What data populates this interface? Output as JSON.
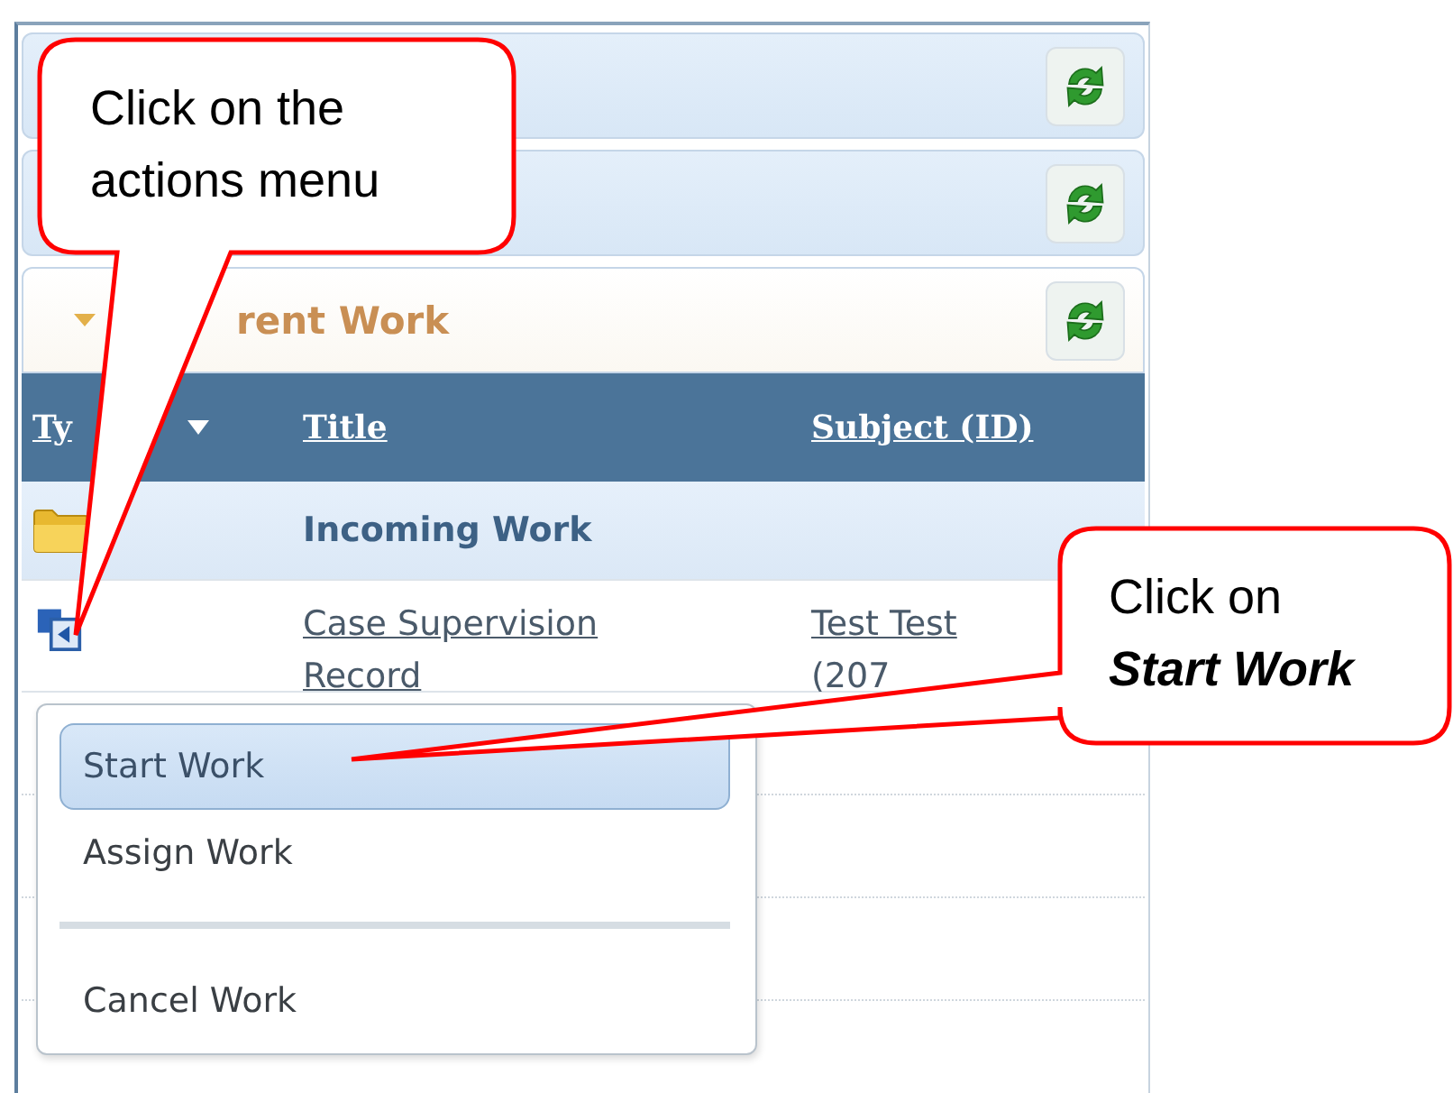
{
  "panels": [
    {
      "expanded": false
    },
    {
      "expanded": false
    },
    {
      "expanded": true,
      "title": "rent Work"
    }
  ],
  "table": {
    "columns": [
      {
        "label": "Ty",
        "sorted": true
      },
      {
        "label": "Title",
        "sorted": false
      },
      {
        "label": "Subject (ID)",
        "sorted": false
      }
    ],
    "rows": [
      {
        "kind": "group",
        "title": "Incoming Work"
      },
      {
        "kind": "item",
        "title": "Case Supervision Record",
        "subject_lines": [
          "Test Test",
          "(207"
        ]
      }
    ]
  },
  "menu": [
    {
      "kind": "item",
      "label": "Start Work",
      "selected": true
    },
    {
      "kind": "item",
      "label": "Assign Work",
      "selected": false
    },
    {
      "kind": "separator"
    },
    {
      "kind": "item",
      "label": "Cancel Work",
      "selected": false
    }
  ],
  "callouts": [
    {
      "lines": [
        {
          "text": "Click on the",
          "emphasis": false
        },
        {
          "text": "actions menu",
          "emphasis": false
        }
      ]
    },
    {
      "lines": [
        {
          "text": "Click on",
          "emphasis": false
        },
        {
          "text": "Start Work",
          "emphasis": true
        }
      ]
    }
  ]
}
